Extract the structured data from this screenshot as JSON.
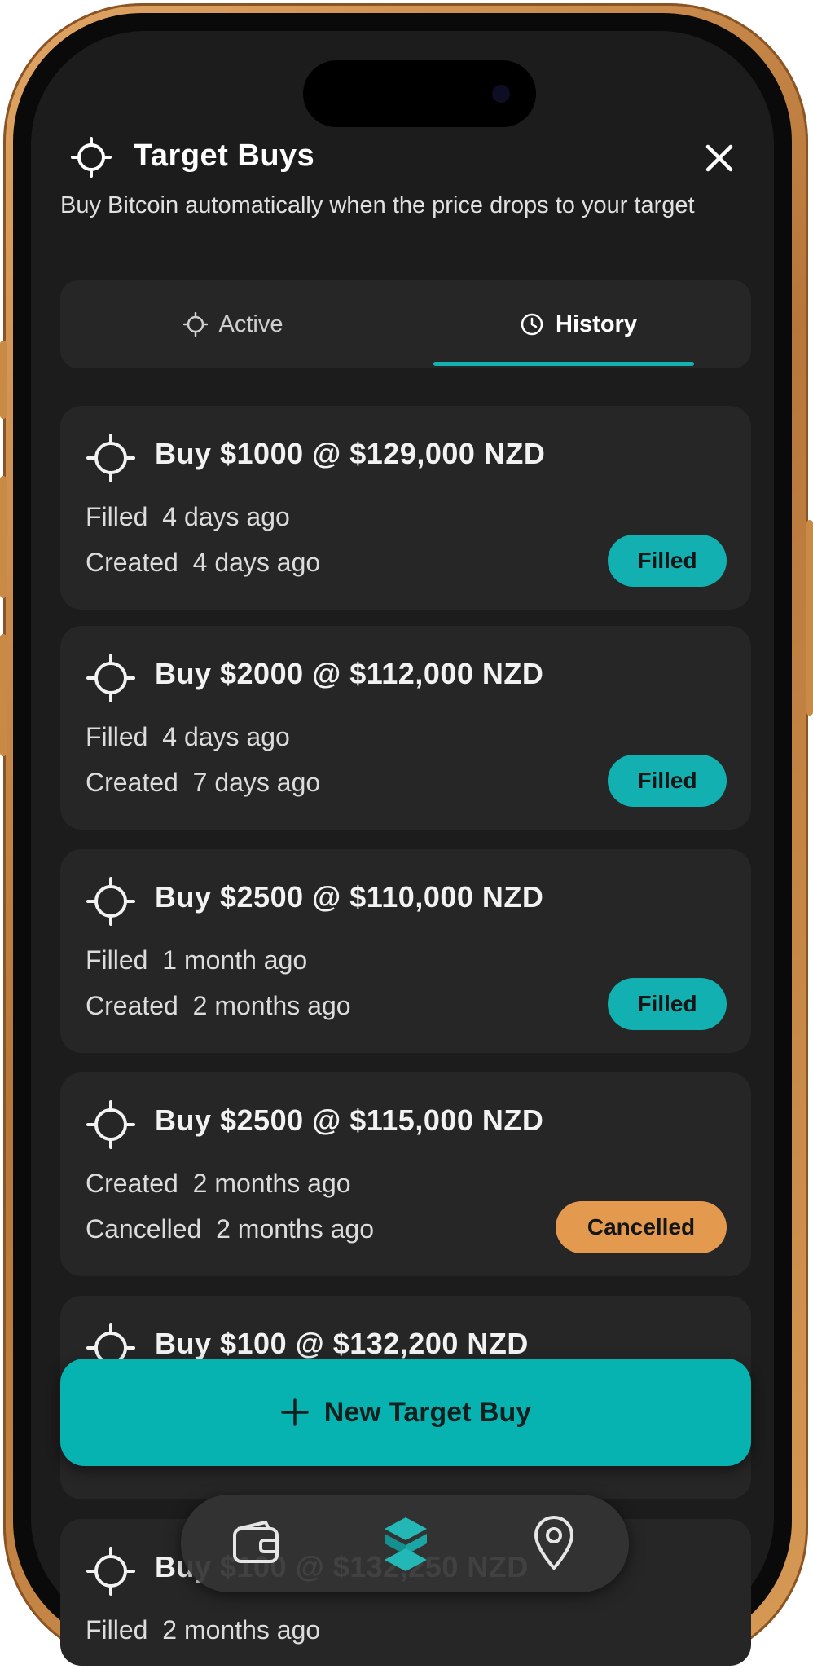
{
  "header": {
    "title": "Target Buys",
    "subtitle": "Buy Bitcoin automatically when the price drops to your target"
  },
  "tabs": {
    "active": "Active",
    "history": "History",
    "selected": "history"
  },
  "orders": [
    {
      "title": "Buy $1000 @ $129,000 NZD",
      "line1": "Filled  4 days ago",
      "line2": "Created  4 days ago",
      "status": "Filled"
    },
    {
      "title": "Buy $2000 @ $112,000 NZD",
      "line1": "Filled  4 days ago",
      "line2": "Created  7 days ago",
      "status": "Filled"
    },
    {
      "title": "Buy $2500 @ $110,000 NZD",
      "line1": "Filled  1 month ago",
      "line2": "Created  2 months ago",
      "status": "Filled"
    },
    {
      "title": "Buy $2500 @ $115,000 NZD",
      "line1": "Created  2 months ago",
      "line2": "Cancelled  2 months ago",
      "status": "Cancelled"
    },
    {
      "title": "Buy $100 @ $132,200 NZD",
      "line1": "",
      "line2": "",
      "status": ""
    },
    {
      "title": "Buy $100 @ $132,250 NZD",
      "line1": "Filled  2 months ago",
      "line2": "",
      "status": ""
    }
  ],
  "actions": {
    "new_target_buy": "New Target Buy"
  },
  "nav": {
    "items": [
      "wallet-icon",
      "home-icon",
      "location-icon"
    ],
    "selected": "home-icon"
  },
  "colors": {
    "accent": "#06b3b1",
    "filled_badge": "#12b0b0",
    "cancelled_badge": "#e49a4e",
    "background": "#1c1c1c",
    "card": "#262626"
  }
}
